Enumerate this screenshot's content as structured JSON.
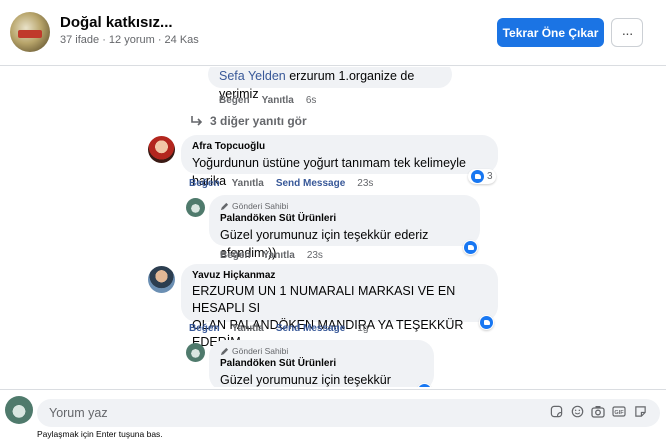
{
  "header": {
    "title": "Doğal katkısız...",
    "meta": "37 ifade · 12 yorum · 24 Kas",
    "promote_label": "Tekrar Öne Çıkar",
    "more_label": "···"
  },
  "thread": {
    "top_partial": {
      "mention": "Sefa Yelden",
      "text": " erzurum 1.organize de yerimiz"
    },
    "top_actions": {
      "like": "Beğen",
      "reply": "Yanıtla",
      "time": "6s"
    },
    "more_replies": "3 diğer yanıtı gör",
    "comments": [
      {
        "name": "Afra Topcuoğlu",
        "text": "Yoğurdunun üstüne yoğurt tanımam tek kelimeyle harika",
        "actions": {
          "like": "Beğen",
          "reply": "Yanıtla",
          "send": "Send Message",
          "time": "23s"
        },
        "reaction_count": "3",
        "reply": {
          "author_tag": "Gönderi Sahibi",
          "name": "Palandöken Süt Ürünleri",
          "text": "Güzel yorumunuz için teşekkür ederiz efendim:))",
          "actions": {
            "like": "Beğen",
            "reply": "Yanıtla",
            "time": "23s"
          }
        }
      },
      {
        "name": "Yavuz Hiçkanmaz",
        "text_line1": "ERZURUM UN 1 NUMARALI MARKASI VE EN HESAPLI SI",
        "text_line2": "OLAN PALANDÖKEN MANDIRA YA TEŞEKKÜR EDERİM",
        "actions": {
          "like": "Beğen",
          "reply": "Yanıtla",
          "send": "Send Message",
          "time": "1g"
        },
        "reply": {
          "author_tag": "Gönderi Sahibi",
          "name": "Palandöken Süt Ürünleri",
          "text": "Güzel yorumunuz için teşekkür ederiz:))"
        }
      }
    ]
  },
  "composer": {
    "placeholder": "Yorum yaz",
    "hint": "Paylaşmak için Enter tuşuna bas."
  },
  "icons": [
    "arrow-reply-icon",
    "pencil-icon",
    "like-icon",
    "sticker-icon",
    "emoji-icon",
    "camera-icon",
    "gif-icon",
    "sticker-alt-icon"
  ],
  "colors": {
    "accent": "#1b74e4",
    "link": "#385898",
    "bubble": "#f0f2f5",
    "muted": "#65676b"
  }
}
